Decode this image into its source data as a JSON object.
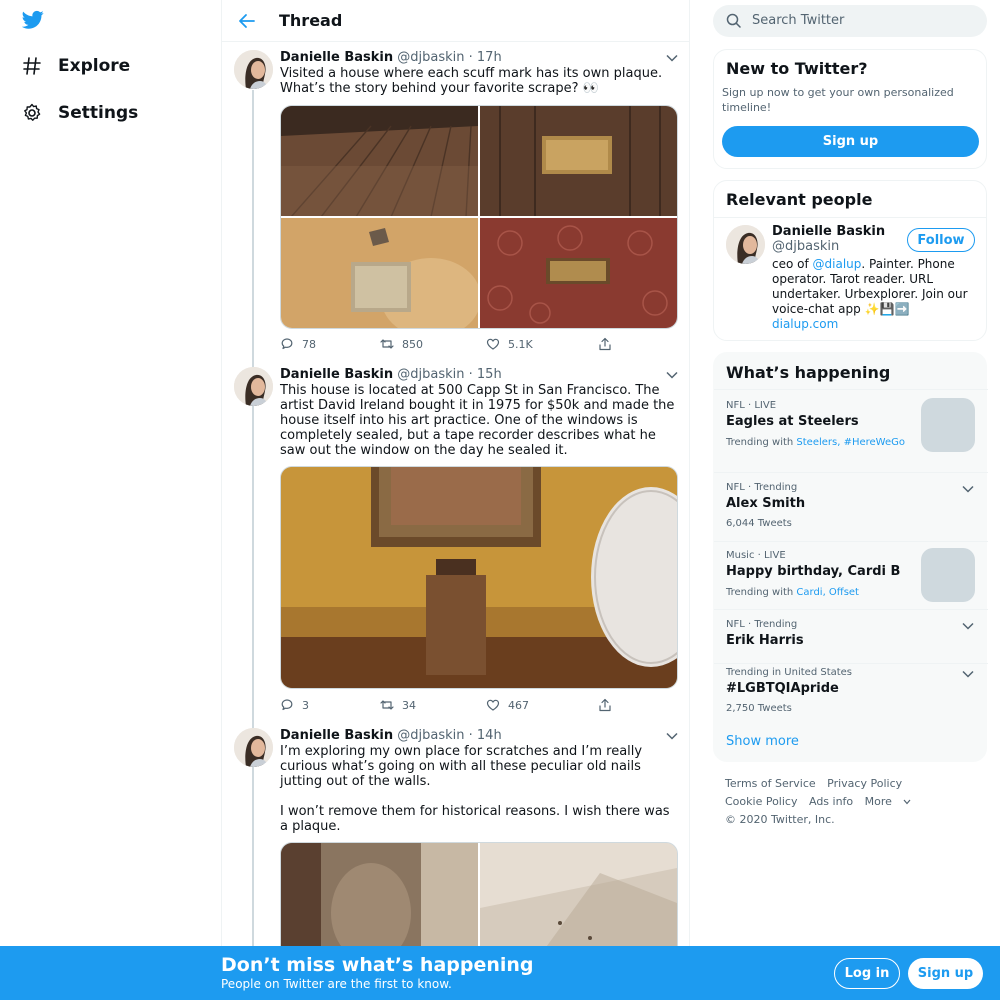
{
  "nav": {
    "logo_icon": "twitter-bird-icon",
    "items": [
      {
        "label": "Explore",
        "icon": "hashtag-icon"
      },
      {
        "label": "Settings",
        "icon": "gear-icon"
      }
    ]
  },
  "thread": {
    "title": "Thread",
    "tweets": [
      {
        "name": "Danielle Baskin",
        "handle": "@djbaskin",
        "time": "· 17h",
        "text": [
          "Visited a house where each scuff mark has its own plaque. What’s the story behind your favorite scrape? 👀"
        ],
        "replies": "78",
        "retweets": "850",
        "likes": "5.1K"
      },
      {
        "name": "Danielle Baskin",
        "handle": "@djbaskin",
        "time": "· 15h",
        "text": [
          "This house is located at 500 Capp St in San Francisco. The artist David Ireland bought it in 1975 for $50k and made the house itself into his art practice. One of the windows is completely sealed, but a tape recorder describes what he saw out the window on the day he sealed it."
        ],
        "replies": "3",
        "retweets": "34",
        "likes": "467"
      },
      {
        "name": "Danielle Baskin",
        "handle": "@djbaskin",
        "time": "· 14h",
        "text": [
          "I’m exploring my own place for scratches and I’m really curious what’s going on with all these peculiar old nails jutting out of the walls.",
          "I won’t remove them for historical reasons. I wish there was a plaque."
        ]
      }
    ]
  },
  "search": {
    "placeholder": "Search Twitter"
  },
  "new_to_twitter": {
    "title": "New to Twitter?",
    "subtitle": "Sign up now to get your own personalized timeline!",
    "button": "Sign up"
  },
  "relevant_people": {
    "title": "Relevant people",
    "name": "Danielle Baskin",
    "handle": "@djbaskin",
    "follow": "Follow",
    "bio_prefix": "ceo of ",
    "bio_mention": "@dialup",
    "bio_rest": ". Painter. Phone operator. Tarot reader. URL undertaker. Urbexplorer. Join our voice-chat app ✨💾➡️",
    "bio_link": "dialup.com"
  },
  "trends": {
    "title": "What’s happening",
    "items": [
      {
        "meta": "NFL · LIVE",
        "title": "Eagles at Steelers",
        "sub_prefix": "Trending with ",
        "sub_links": "Steelers, #HereWeGo"
      },
      {
        "meta": "NFL · Trending",
        "title": "Alex Smith",
        "sub": "6,044 Tweets"
      },
      {
        "meta": "Music · LIVE",
        "title": "Happy birthday, Cardi B",
        "sub_prefix": "Trending with ",
        "sub_links": "Cardi, Offset"
      },
      {
        "meta": "NFL · Trending",
        "title": "Erik Harris"
      },
      {
        "meta": "Trending in United States",
        "title": "#LGBTQIApride",
        "sub": "2,750 Tweets"
      }
    ],
    "show_more": "Show more"
  },
  "footer": {
    "links": [
      "Terms of Service",
      "Privacy Policy",
      "Cookie Policy",
      "Ads info",
      "More",
      "© 2020 Twitter, Inc."
    ]
  },
  "bottom_bar": {
    "title": "Don’t miss what’s happening",
    "subtitle": "People on Twitter are the first to know.",
    "login": "Log in",
    "signup": "Sign up"
  },
  "colors": {
    "accent": "#1d9bf0",
    "text": "#0f1419",
    "muted": "#536471"
  }
}
